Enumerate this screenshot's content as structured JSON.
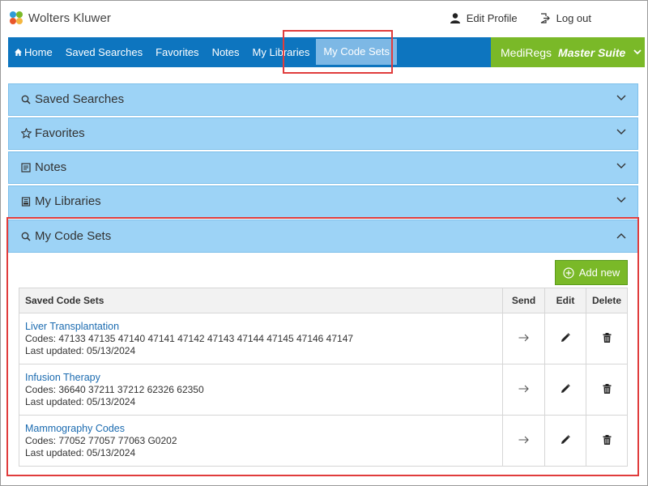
{
  "header": {
    "brand": "Wolters Kluwer",
    "edit_profile": "Edit Profile",
    "log_out": "Log out"
  },
  "nav": {
    "items": [
      "Home",
      "Saved Searches",
      "Favorites",
      "Notes",
      "My Libraries",
      "My Code Sets"
    ],
    "active": "My Code Sets",
    "suite_name": "MediRegs",
    "suite_product": "Master Suite"
  },
  "accordion": [
    {
      "title": "Saved Searches",
      "icon": "search-icon",
      "expanded": false
    },
    {
      "title": "Favorites",
      "icon": "star-icon",
      "expanded": false
    },
    {
      "title": "Notes",
      "icon": "note-icon",
      "expanded": false
    },
    {
      "title": "My Libraries",
      "icon": "book-icon",
      "expanded": false
    },
    {
      "title": "My Code Sets",
      "icon": "search-icon",
      "expanded": true
    }
  ],
  "code_sets": {
    "add_label": "Add new",
    "columns": [
      "Saved Code Sets",
      "Send",
      "Edit",
      "Delete"
    ],
    "rows": [
      {
        "name": "Liver Transplantation",
        "codes": "Codes: 47133 47135 47140 47141 47142 47143 47144 47145 47146 47147",
        "updated": "Last updated: 05/13/2024"
      },
      {
        "name": "Infusion Therapy",
        "codes": "Codes: 36640 37211 37212 62326 62350",
        "updated": "Last updated: 05/13/2024"
      },
      {
        "name": "Mammography Codes",
        "codes": "Codes: 77052 77057 77063 G0202",
        "updated": "Last updated: 05/13/2024"
      }
    ]
  },
  "colors": {
    "nav_blue": "#0d75bf",
    "active_tab": "#7db8e5",
    "suite_green": "#7ab928",
    "accordion_blue": "#9dd3f6",
    "highlight_red": "#e03c3c",
    "link_blue": "#1b6bb0"
  }
}
